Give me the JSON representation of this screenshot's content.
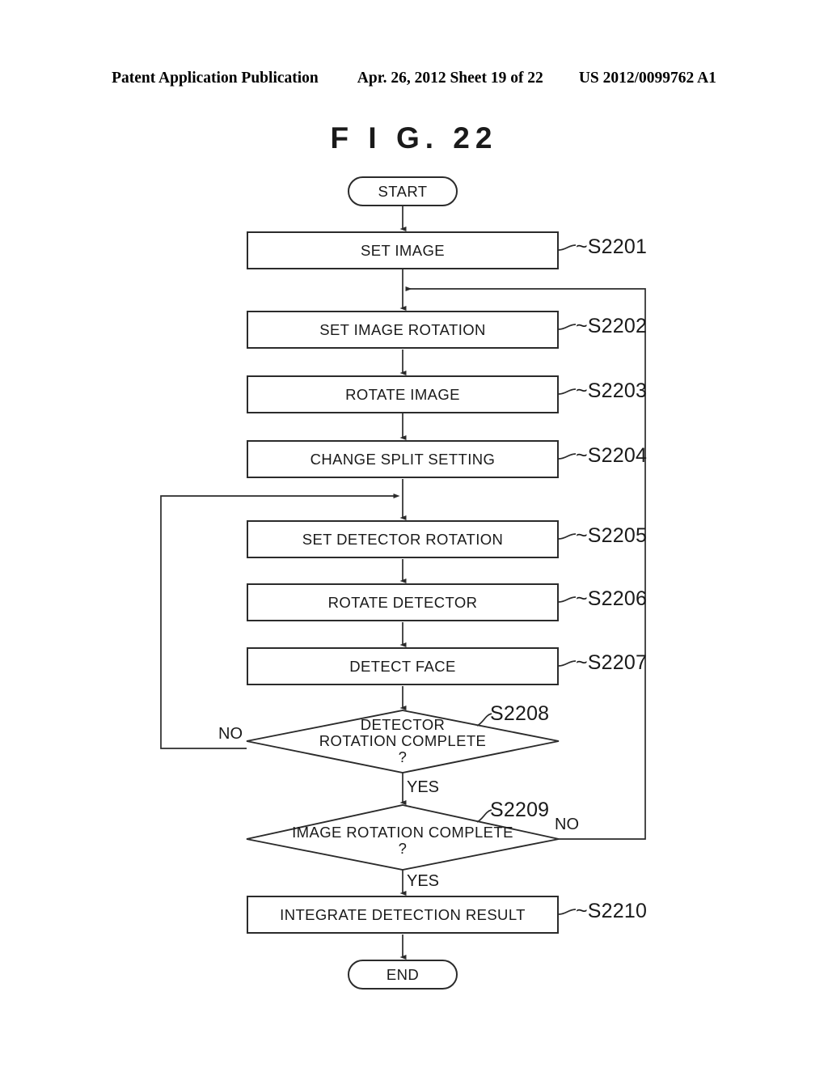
{
  "header": {
    "publication": "Patent Application Publication",
    "date_sheet": "Apr. 26, 2012  Sheet 19 of 22",
    "pub_number": "US 2012/0099762 A1"
  },
  "figure": {
    "title": "F I G.  22"
  },
  "flowchart": {
    "start_label": "START",
    "end_label": "END",
    "steps": [
      {
        "id": "S2201",
        "label": "SET IMAGE",
        "ref": "~S2201"
      },
      {
        "id": "S2202",
        "label": "SET IMAGE ROTATION",
        "ref": "~S2202"
      },
      {
        "id": "S2203",
        "label": "ROTATE IMAGE",
        "ref": "~S2203"
      },
      {
        "id": "S2204",
        "label": "CHANGE SPLIT SETTING",
        "ref": "~S2204"
      },
      {
        "id": "S2205",
        "label": "SET DETECTOR ROTATION",
        "ref": "~S2205"
      },
      {
        "id": "S2206",
        "label": "ROTATE DETECTOR",
        "ref": "~S2206"
      },
      {
        "id": "S2207",
        "label": "DETECT FACE",
        "ref": "~S2207"
      },
      {
        "id": "S2210",
        "label": "INTEGRATE DETECTION RESULT",
        "ref": "~S2210"
      }
    ],
    "decisions": [
      {
        "id": "S2208",
        "ref": "S2208",
        "line1": "DETECTOR",
        "line2": "ROTATION COMPLETE",
        "line3": "?",
        "no_label": "NO",
        "yes_label": "YES"
      },
      {
        "id": "S2209",
        "ref": "S2209",
        "line1": "IMAGE ROTATION COMPLETE",
        "line2": "?",
        "no_label": "NO",
        "yes_label": "YES"
      }
    ]
  },
  "colors": {
    "ink": "#1a1a1a",
    "stroke": "#2b2b2b",
    "paper": "#ffffff"
  }
}
